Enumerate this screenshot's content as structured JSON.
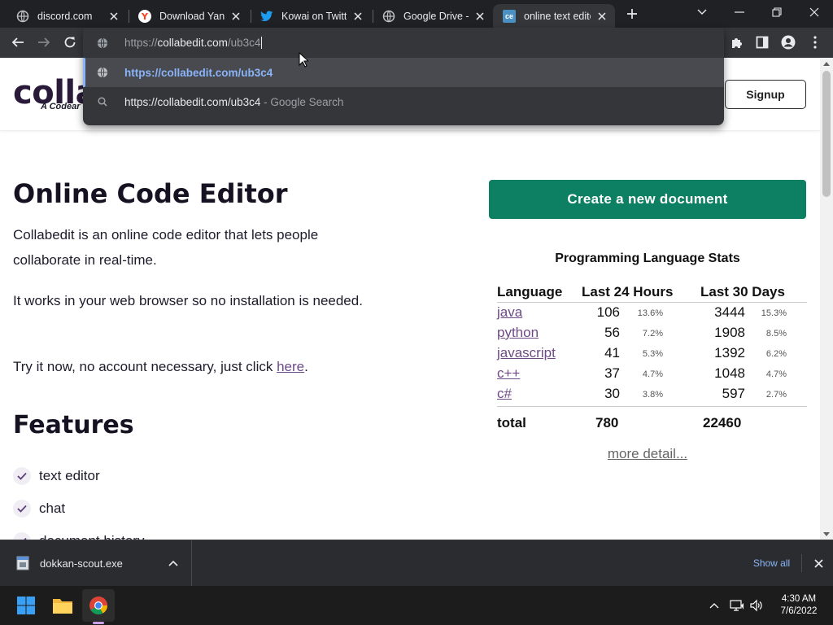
{
  "tabs": [
    {
      "title": "discord.com",
      "icon": "globe-icon",
      "active": false
    },
    {
      "title": "Download Yand",
      "icon": "yandex-icon",
      "active": false
    },
    {
      "title": "Kowai on Twitte",
      "icon": "twitter-icon",
      "active": false
    },
    {
      "title": "Google Drive - V",
      "icon": "globe-icon",
      "active": false
    },
    {
      "title": "online text editor",
      "icon": "collabedit-icon",
      "active": true
    }
  ],
  "collabedit_favicon_text": "ce",
  "omnibox": {
    "input_prefix": "https://",
    "input_host": "collabedit.com",
    "input_path": "/ub3c4",
    "suggestion_url": "https://collabedit.com/ub3c4",
    "suggestion_search": "https://collabedit.com/ub3c4",
    "suggestion_search_suffix": " - Google Search"
  },
  "site": {
    "logo": "colla",
    "logo_sub": "A Codear",
    "signup_label": "Signup"
  },
  "main": {
    "title": "Online Code Editor",
    "para1": "Collabedit is an online code editor that lets people collaborate in real-time.",
    "para2": "It works in your web browser so no installation is needed.",
    "para3_text": "Try it now, no account necessary, just click ",
    "para3_link": "here",
    "para3_end": ".",
    "features_title": "Features",
    "features": [
      "text editor",
      "chat",
      "document history"
    ]
  },
  "stats": {
    "create_label": "Create a new document",
    "title": "Programming Language Stats",
    "headers": {
      "language": "Language",
      "last24": "Last 24 Hours",
      "last30": "Last 30 Days"
    },
    "rows": [
      {
        "language": "java",
        "h24": "106",
        "h24p": "13.6%",
        "d30": "3444",
        "d30p": "15.3%"
      },
      {
        "language": "python",
        "h24": "56",
        "h24p": "7.2%",
        "d30": "1908",
        "d30p": "8.5%"
      },
      {
        "language": "javascript",
        "h24": "41",
        "h24p": "5.3%",
        "d30": "1392",
        "d30p": "6.2%"
      },
      {
        "language": "c++",
        "h24": "37",
        "h24p": "4.7%",
        "d30": "1048",
        "d30p": "4.7%"
      },
      {
        "language": "c#",
        "h24": "30",
        "h24p": "3.8%",
        "d30": "597",
        "d30p": "2.7%"
      }
    ],
    "total_label": "total",
    "total_24": "780",
    "total_30": "22460",
    "more_label": "more detail..."
  },
  "download": {
    "file_name": "dokkan-scout.exe",
    "show_all": "Show all"
  },
  "taskbar": {
    "time": "4:30 AM",
    "date": "7/6/2022"
  },
  "colors": {
    "accent_green": "#0d7f62",
    "link_purple": "#6e4a86",
    "omnibox_link": "#8ab4f8"
  }
}
